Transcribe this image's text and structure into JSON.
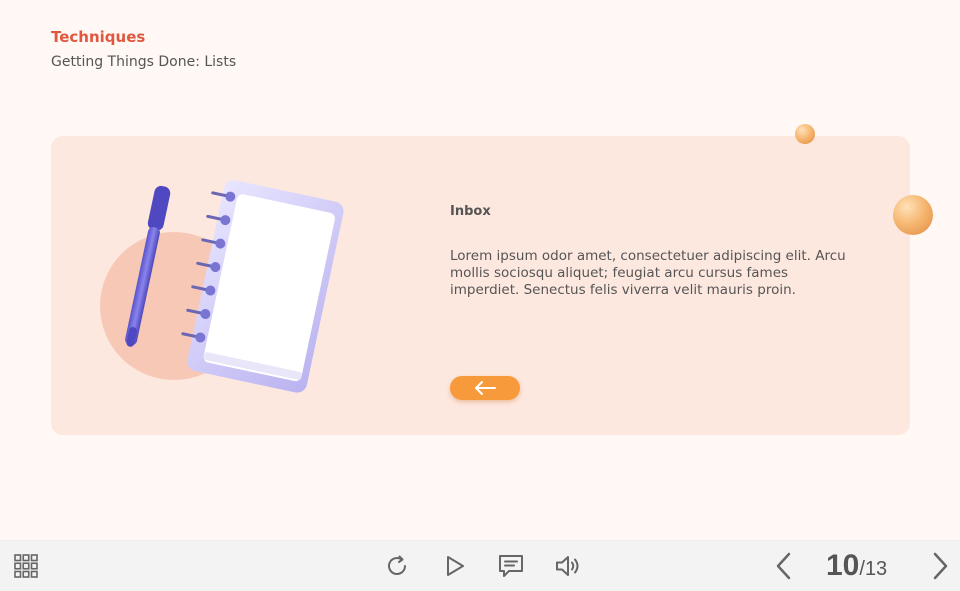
{
  "header": {
    "section_title": "Techniques",
    "subtitle": "Getting Things Done: Lists"
  },
  "card": {
    "title": "Inbox",
    "body": "Lorem ipsum odor amet, consectetuer adipiscing elit. Arcu mollis sociosqu aliquet; feugiat arcu cursus fames imperdiet. Senectus felis viverra velit mauris proin.",
    "back_button_icon": "arrow-left-icon"
  },
  "colors": {
    "accent": "#f79a3c",
    "title_red": "#e0583f",
    "card_bg": "#fde8df",
    "page_bg": "#fff8f5",
    "text": "#555555"
  },
  "toolbar": {
    "icons": [
      "grid-menu-icon",
      "replay-icon",
      "play-icon",
      "transcript-icon",
      "volume-icon",
      "prev-arrow-icon",
      "next-arrow-icon"
    ],
    "page_current": "10",
    "page_separator": "/",
    "page_total": "13"
  }
}
